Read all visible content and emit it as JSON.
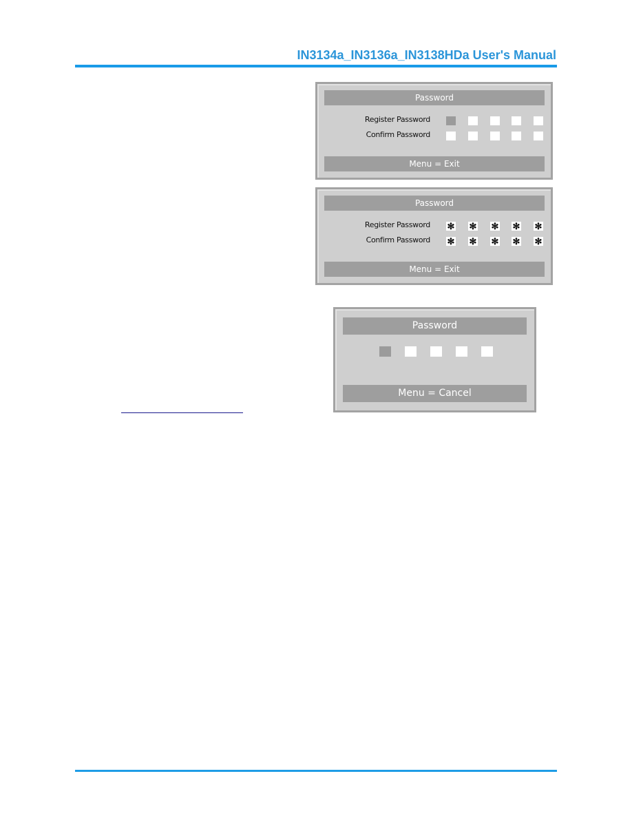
{
  "header": {
    "title": "IN3134a_IN3136a_IN3138HDa User's Manual",
    "accent_color": "#1a9be8"
  },
  "dialogs": [
    {
      "title": "Password",
      "rows": [
        {
          "label": "Register Password",
          "cells": [
            "",
            "",
            "",
            "",
            ""
          ],
          "active_index": 0
        },
        {
          "label": "Confirm Password",
          "cells": [
            "",
            "",
            "",
            "",
            ""
          ],
          "active_index": -1
        }
      ],
      "footer": "Menu = Exit"
    },
    {
      "title": "Password",
      "rows": [
        {
          "label": "Register Password",
          "cells": [
            "✻",
            "✻",
            "✻",
            "✻",
            "✻"
          ],
          "active_index": -1
        },
        {
          "label": "Confirm Password",
          "cells": [
            "✻",
            "✻",
            "✻",
            "✻",
            "✻"
          ],
          "active_index": -1
        }
      ],
      "footer": "Menu = Exit"
    },
    {
      "title": "Password",
      "rows": [
        {
          "label": "",
          "cells": [
            "",
            "",
            "",
            "",
            ""
          ],
          "active_index": 0
        }
      ],
      "footer": "Menu = Cancel"
    }
  ],
  "icons": {
    "masked_char": "asterisk-icon"
  }
}
